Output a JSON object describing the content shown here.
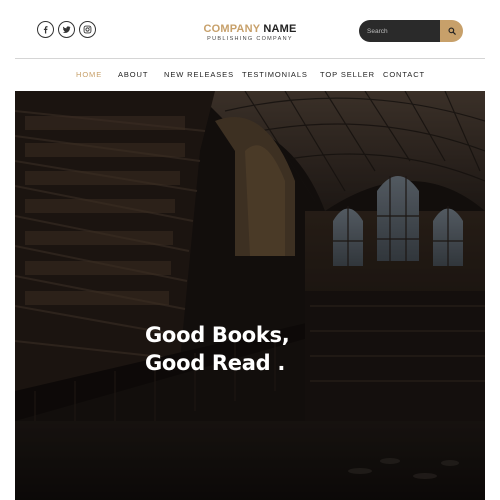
{
  "header": {
    "social": [
      {
        "icon": "facebook-icon"
      },
      {
        "icon": "twitter-icon"
      },
      {
        "icon": "instagram-icon"
      }
    ],
    "brand": {
      "name_accent": "COMPANY",
      "name_rest": " NAME",
      "tagline": "PUBLISHING COMPANY"
    },
    "search": {
      "placeholder": "Search",
      "button_icon": "search-icon"
    }
  },
  "nav": {
    "items": [
      {
        "label": "HOME",
        "active": true
      },
      {
        "label": "ABOUT",
        "active": false
      },
      {
        "label": "NEW RELEASES",
        "active": false
      },
      {
        "label": "TESTIMONIALS",
        "active": false
      },
      {
        "label": "TOP SELLER",
        "active": false
      },
      {
        "label": "CONTACT",
        "active": false
      }
    ]
  },
  "hero": {
    "line1": "Good Books,",
    "line2": "Good Read ."
  },
  "colors": {
    "accent": "#c7a06a",
    "dark": "#222222",
    "search_bg": "#2a2a2a"
  }
}
